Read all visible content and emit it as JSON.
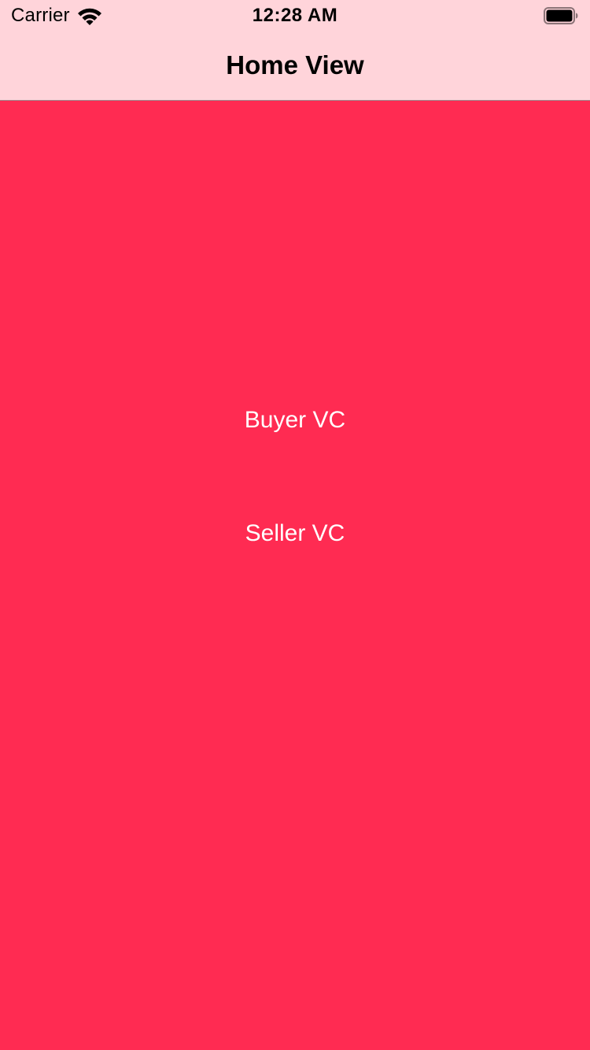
{
  "status_bar": {
    "carrier": "Carrier",
    "time": "12:28 AM",
    "icons": [
      "wifi-icon",
      "battery-icon"
    ]
  },
  "nav_bar": {
    "title": "Home View"
  },
  "main": {
    "buttons": [
      {
        "label": "Buyer VC"
      },
      {
        "label": "Seller VC"
      }
    ]
  },
  "colors": {
    "nav_background": "#ffd4da",
    "content_background": "#ff2b52",
    "button_text": "#ffffff"
  }
}
